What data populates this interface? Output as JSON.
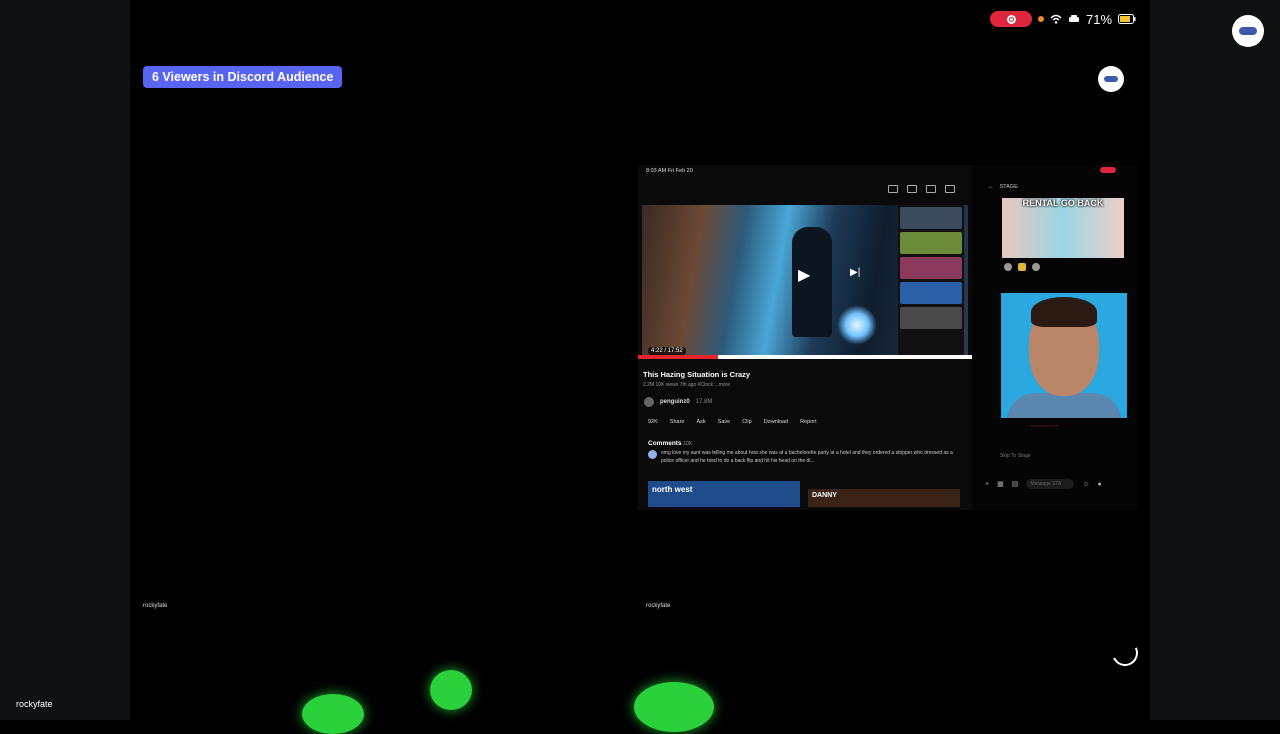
{
  "status_bar": {
    "battery": "71%"
  },
  "stage": {
    "viewers_badge": "6 Viewers in Discord Audience",
    "tile_label_left": "rockyfate",
    "tile_label_right": "rockyfate",
    "corner_label": "rockyfate"
  },
  "phone": {
    "clock": "8:03 AM  Fri Feb 20",
    "youtube": {
      "time": "4:22 / 17:52",
      "progress": 0.24,
      "title": "This Hazing Situation is Crazy",
      "meta": "2.2M 10K views  7th ago  #Clock  ...more",
      "channel": "penguinz0",
      "subs": "17.8M",
      "actions": [
        "92K",
        "Share",
        "Ask",
        "Save",
        "Clip",
        "Download",
        "Report"
      ],
      "comments_label": "Comments",
      "comments_count": "10K",
      "comment_text": "omg love my aunt was telling me about how she was at a bachelorette party at a hotel and they ordered a stripper who dressed as a police officer and he tried to do a back flip and hit his head on the di...",
      "ad_left": "north west",
      "ad_right": "DANNY"
    },
    "discord": {
      "header": "STAGE",
      "overlay_text": "RENTAL GO BACK",
      "footer": "Skip To Stage",
      "input_placeholder": "Message STA"
    }
  },
  "colors": {
    "badge_bg": "#5865f2",
    "record": "#e0263c",
    "yt_red": "#e6262b"
  }
}
